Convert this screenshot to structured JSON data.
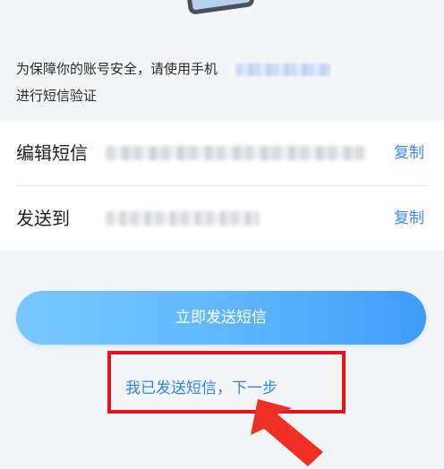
{
  "intro": {
    "line1": "为保障你的账号安全，请使用手机",
    "line2": "进行短信验证"
  },
  "rows": {
    "message": {
      "label": "编辑短信",
      "copy": "复制"
    },
    "sendTo": {
      "label": "发送到",
      "copy": "复制"
    }
  },
  "actions": {
    "sendNow": "立即发送短信",
    "next": "我已发送短信，下一步"
  },
  "colors": {
    "accent": "#3d8ae6",
    "buttonStart": "#78c7ff",
    "buttonEnd": "#3f9cf8",
    "highlight": "#e8121f"
  },
  "icons": {
    "topDecoration": "phone-icon",
    "annotation": "arrow-icon"
  }
}
